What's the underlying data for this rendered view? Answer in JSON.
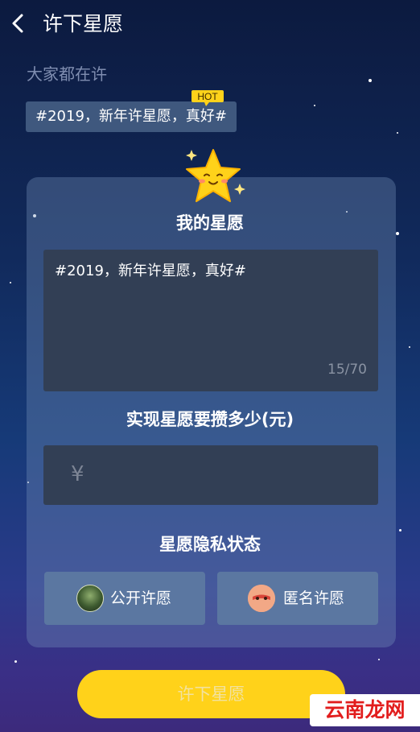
{
  "header": {
    "title": "许下星愿"
  },
  "trending": {
    "label": "大家都在许",
    "tag": "#2019，新年许星愿，真好#",
    "badge": "HOT"
  },
  "wish": {
    "heading": "我的星愿",
    "text": "#2019，新年许星愿，真好#",
    "counter": "15/70"
  },
  "amount": {
    "heading": "实现星愿要攒多少(元)",
    "currency_symbol": "¥",
    "value": ""
  },
  "privacy": {
    "heading": "星愿隐私状态",
    "options": [
      {
        "label": "公开许愿"
      },
      {
        "label": "匿名许愿"
      }
    ]
  },
  "submit": {
    "label": "许下星愿"
  },
  "watermark": {
    "text": "云南龙网"
  },
  "colors": {
    "accent": "#ffd21a",
    "panel": "#323f55",
    "option_bg": "#5b77a1"
  }
}
